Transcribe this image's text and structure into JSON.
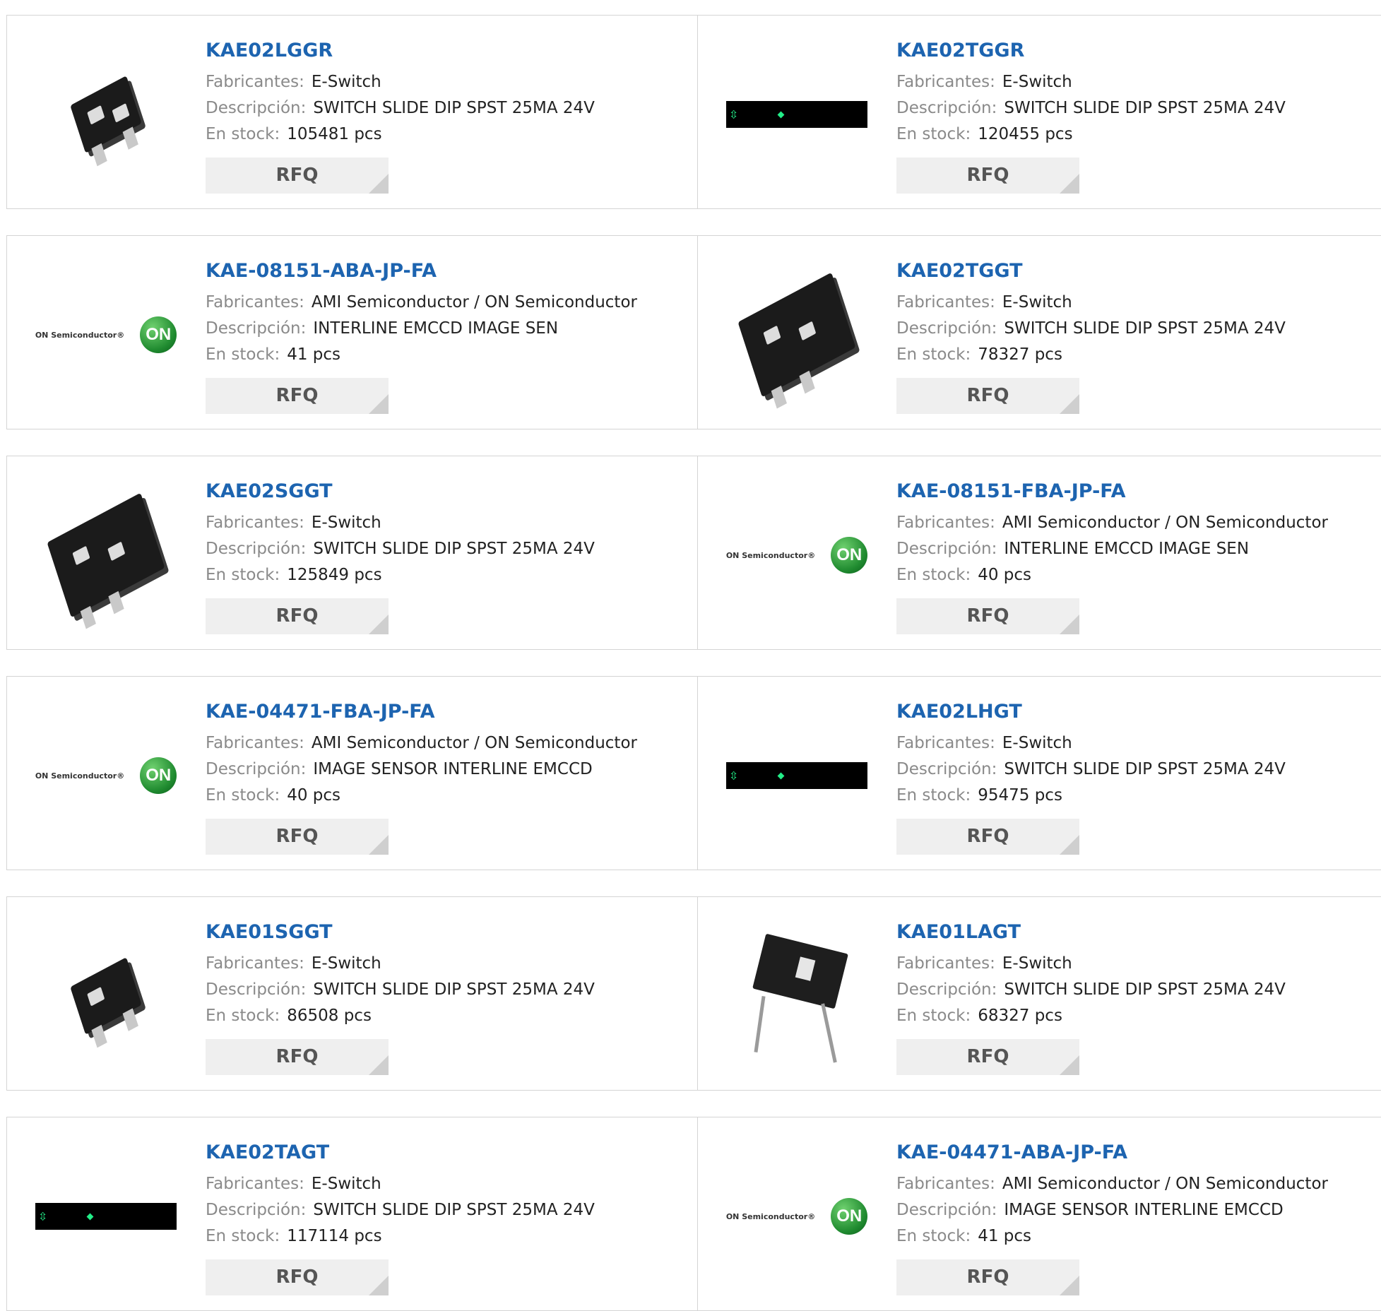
{
  "labels": {
    "manufacturer": "Fabricantes:",
    "description": "Descripción:",
    "stock": "En stock:",
    "rfq": "RFQ"
  },
  "products": [
    {
      "pn": "KAE02LGGR",
      "mfr": "E-Switch",
      "desc": "SWITCH SLIDE DIP SPST 25MA 24V",
      "stock": "105481 pcs",
      "image": "dip-switch-2pos-small"
    },
    {
      "pn": "KAE02TGGR",
      "mfr": "E-Switch",
      "desc": "SWITCH SLIDE DIP SPST 25MA 24V",
      "stock": "120455 pcs",
      "image": "black-banner-green-arrows"
    },
    {
      "pn": "KAE-08151-ABA-JP-FA",
      "mfr": "AMI Semiconductor / ON Semiconductor",
      "desc": "INTERLINE EMCCD IMAGE SEN",
      "stock": "41 pcs",
      "image": "on-semiconductor-logo"
    },
    {
      "pn": "KAE02TGGT",
      "mfr": "E-Switch",
      "desc": "SWITCH SLIDE DIP SPST 25MA 24V",
      "stock": "78327 pcs",
      "image": "dip-switch-2pos-large"
    },
    {
      "pn": "KAE02SGGT",
      "mfr": "E-Switch",
      "desc": "SWITCH SLIDE DIP SPST 25MA 24V",
      "stock": "125849 pcs",
      "image": "dip-switch-2pos-large"
    },
    {
      "pn": "KAE-08151-FBA-JP-FA",
      "mfr": "AMI Semiconductor / ON Semiconductor",
      "desc": "INTERLINE EMCCD IMAGE SEN",
      "stock": "40 pcs",
      "image": "on-semiconductor-logo"
    },
    {
      "pn": "KAE-04471-FBA-JP-FA",
      "mfr": "AMI Semiconductor / ON Semiconductor",
      "desc": "IMAGE SENSOR INTERLINE EMCCD",
      "stock": "40 pcs",
      "image": "on-semiconductor-logo"
    },
    {
      "pn": "KAE02LHGT",
      "mfr": "E-Switch",
      "desc": "SWITCH SLIDE DIP SPST 25MA 24V",
      "stock": "95475 pcs",
      "image": "black-banner-green-arrows"
    },
    {
      "pn": "KAE01SGGT",
      "mfr": "E-Switch",
      "desc": "SWITCH SLIDE DIP SPST 25MA 24V",
      "stock": "86508 pcs",
      "image": "dip-switch-1pos-small"
    },
    {
      "pn": "KAE01LAGT",
      "mfr": "E-Switch",
      "desc": "SWITCH SLIDE DIP SPST 25MA 24V",
      "stock": "68327 pcs",
      "image": "dip-switch-1pos-legs"
    },
    {
      "pn": "KAE02TAGT",
      "mfr": "E-Switch",
      "desc": "SWITCH SLIDE DIP SPST 25MA 24V",
      "stock": "117114 pcs",
      "image": "black-banner-green-arrows"
    },
    {
      "pn": "KAE-04471-ABA-JP-FA",
      "mfr": "AMI Semiconductor / ON Semiconductor",
      "desc": "IMAGE SENSOR INTERLINE EMCCD",
      "stock": "41 pcs",
      "image": "on-semiconductor-logo"
    }
  ],
  "logo_text": {
    "onsemi_name": "ON Semiconductor",
    "onsemi_mark": "ON",
    "onsemi_reg": "®"
  },
  "colors": {
    "link": "#1d64b0",
    "label": "#8a8a8a",
    "button_bg": "#efefef",
    "on_green": "#1f8a2f",
    "banner_green": "#22ee88"
  }
}
